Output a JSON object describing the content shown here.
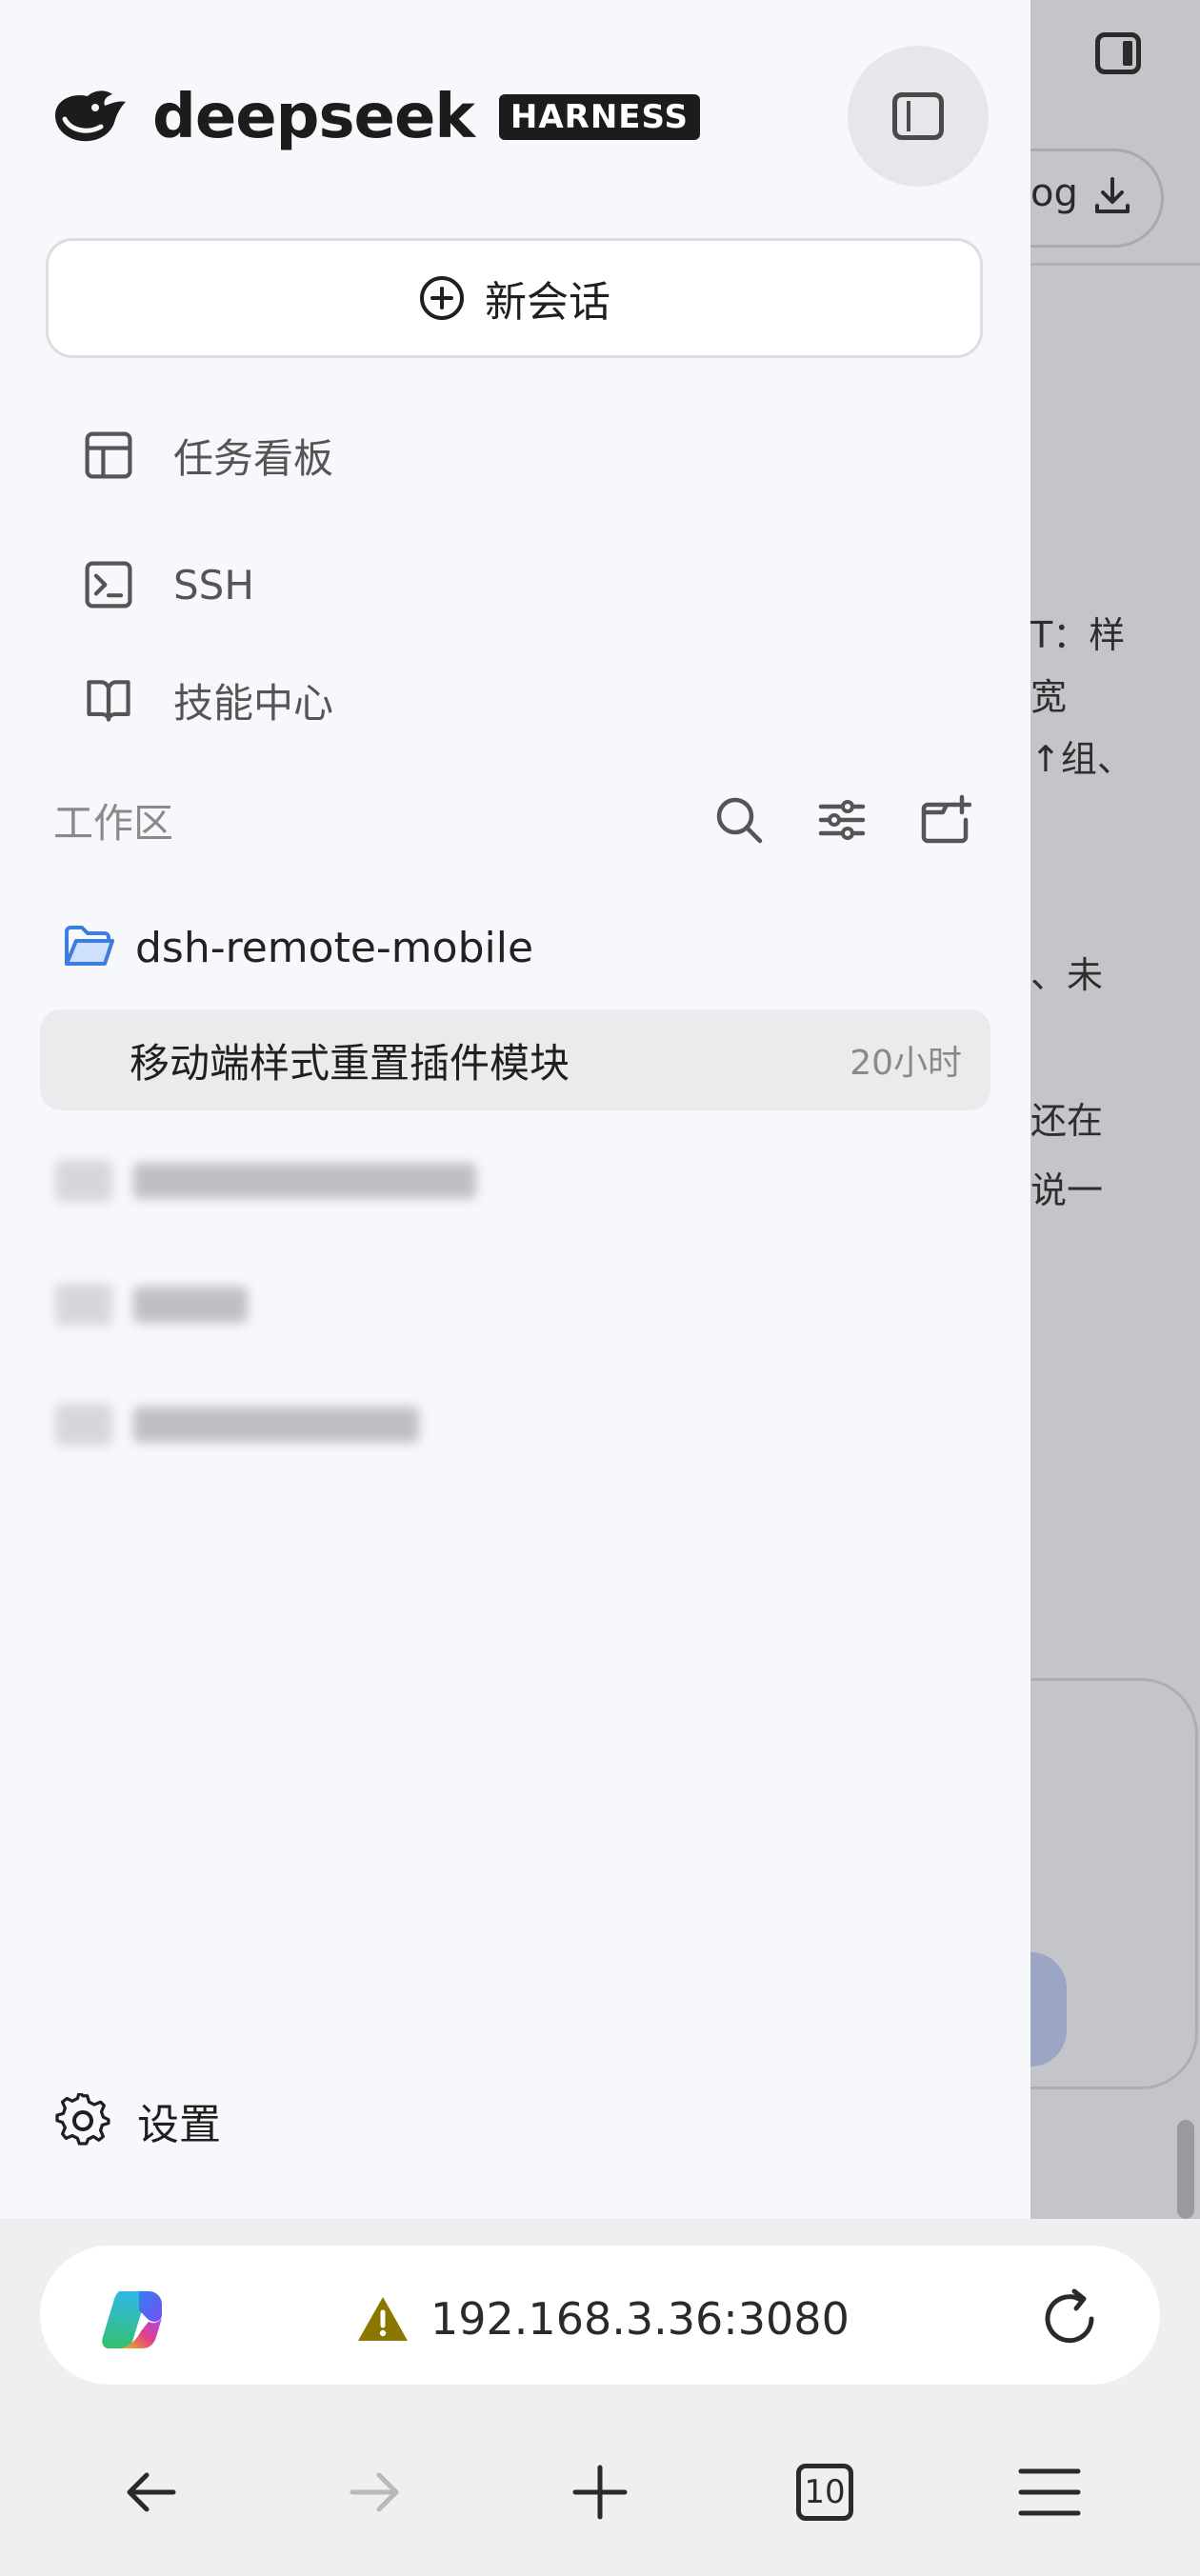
{
  "drawer": {
    "logo_text": "deepseek",
    "logo_badge": "HARNESS",
    "new_chat_label": "新会话",
    "nav": [
      {
        "label": "任务看板",
        "icon": "layout-board-icon"
      },
      {
        "label": "SSH",
        "icon": "terminal-icon"
      },
      {
        "label": "技能中心",
        "icon": "book-open-icon"
      }
    ],
    "workspace": {
      "title": "工作区",
      "folder": "dsh-remote-mobile",
      "session": {
        "title": "移动端样式重置插件模块",
        "time": "20小时"
      }
    },
    "settings_label": "设置"
  },
  "background": {
    "log_button": "og",
    "text_fragments": [
      "T：样",
      "宽",
      "↑组、",
      "、未",
      "还在",
      "说一"
    ]
  },
  "browser": {
    "url": "192.168.3.36:3080",
    "tab_count": "10"
  },
  "colors": {
    "drawer_bg": "#f7f8fc",
    "folder_blue": "#3d7de0",
    "warning": "#8a7600"
  }
}
